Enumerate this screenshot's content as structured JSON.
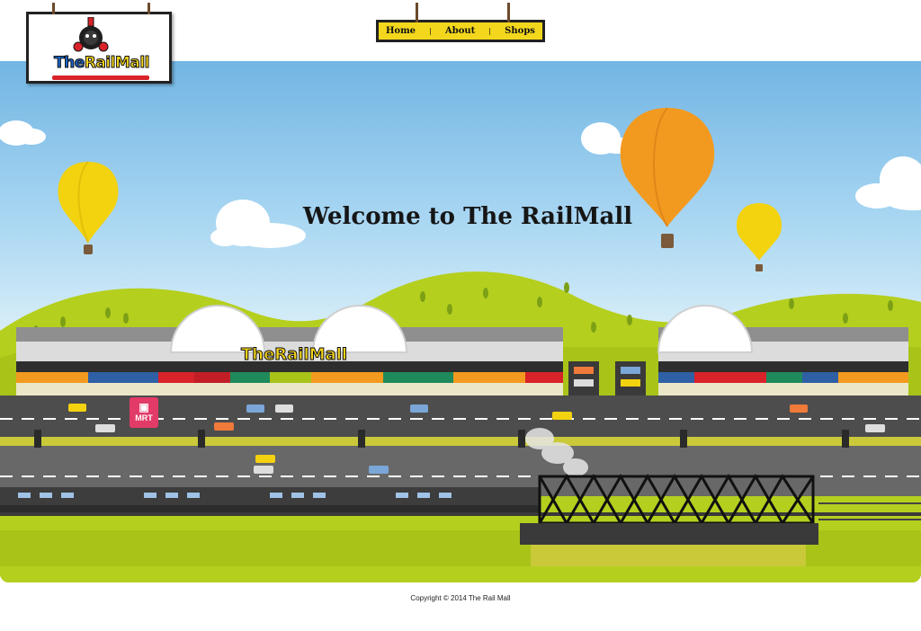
{
  "header": {
    "logo": {
      "text_main": "The",
      "text_accent": "RailMall",
      "icon": "steam-train-icon"
    },
    "nav": [
      {
        "label": "Home"
      },
      {
        "label": "About"
      },
      {
        "label": "Shops"
      }
    ]
  },
  "hero": {
    "title": "Welcome to The RailMall",
    "mall_sign": "TheRailMall",
    "station_sign": "MRT"
  },
  "footer": {
    "copyright": "Copyright © 2014 The Rail Mall"
  },
  "colors": {
    "sky": "#8cc7ec",
    "hills": "#b5cf1e",
    "road": "#4d4d4d",
    "nav_yellow": "#f3d71d",
    "balloon_yellow": "#f3d20f",
    "balloon_orange": "#f29a1f",
    "mrt_pink": "#e23b67"
  }
}
